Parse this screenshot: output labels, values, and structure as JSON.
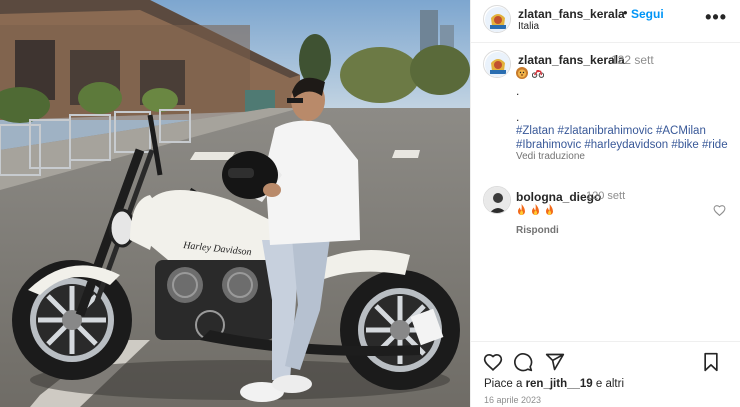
{
  "post": {
    "username": "zlatan_fans_kerala",
    "separator": "•",
    "follow_label": "Segui",
    "location": "Italia",
    "more_label": "•••"
  },
  "caption": {
    "username": "zlatan_fans_kerala",
    "time": "122 sett",
    "emojis": [
      "lion-face-emoji",
      "motorcycle-emoji"
    ],
    "dot1": ".",
    "dot2": ".",
    "hashtags_line1": "#Zlatan #zlatanibrahimovic #ACMilan",
    "hashtags_line2": "#Ibrahimovic #harleydavidson #bike #ride",
    "see_translation": "Vedi traduzione"
  },
  "comment": {
    "username": "bologna_diego",
    "time": "120 sett",
    "emojis": [
      "fire-emoji",
      "fire-emoji",
      "fire-emoji"
    ],
    "reply_label": "Rispondi"
  },
  "actions": {
    "icons": [
      "heart-icon",
      "comment-icon",
      "share-icon",
      "save-icon"
    ]
  },
  "likes": {
    "prefix": "Piace a",
    "user": "ren_jith__19",
    "suffix": "e altri"
  },
  "date": "16 aprile 2023",
  "photo": {
    "bike_brand": "Harley-Davidson"
  },
  "colors": {
    "link": "#0095f6",
    "hashtag": "#385898",
    "muted": "#8e8e8e"
  }
}
